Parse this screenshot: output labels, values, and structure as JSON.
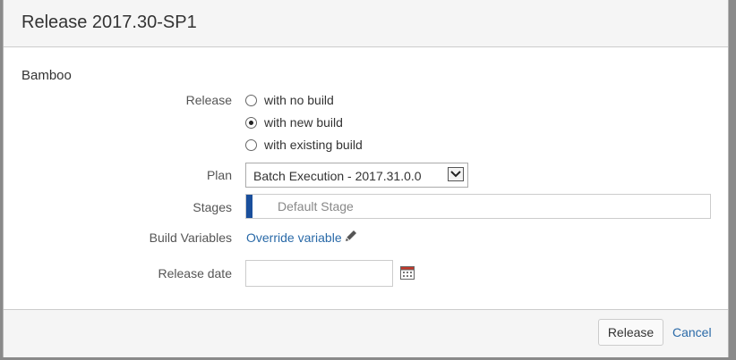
{
  "dialog": {
    "title": "Release 2017.30-SP1",
    "section": "Bamboo"
  },
  "form": {
    "release_label": "Release",
    "release_options": [
      {
        "label": "with no build",
        "checked": false
      },
      {
        "label": "with new build",
        "checked": true
      },
      {
        "label": "with existing build",
        "checked": false
      }
    ],
    "plan_label": "Plan",
    "plan_value": "Batch Execution - 2017.31.0.0",
    "stages_label": "Stages",
    "stages_value": "Default Stage",
    "build_variables_label": "Build Variables",
    "override_link": "Override variable",
    "release_date_label": "Release date",
    "release_date_value": ""
  },
  "footer": {
    "release_button": "Release",
    "cancel_link": "Cancel"
  },
  "colors": {
    "link": "#2a6aa8",
    "stage_accent": "#1a4f9c"
  },
  "icons": [
    "chevron-down-icon",
    "pencil-icon",
    "calendar-icon"
  ]
}
